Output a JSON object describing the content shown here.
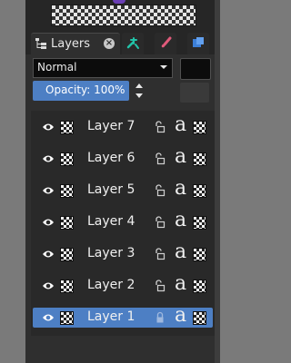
{
  "top": {
    "preview_icon": "checkerboard-preview-icon"
  },
  "tabs": {
    "layers_label": "Layers",
    "close_icon": "close-icon",
    "other_icons": [
      "tools-icon",
      "brush-icon",
      "package-icon"
    ]
  },
  "controls": {
    "blend_mode": "Normal",
    "opacity_label": "Opacity: 100%"
  },
  "layers": [
    {
      "name": "Layer 7",
      "locked": false,
      "selected": false
    },
    {
      "name": "Layer 6",
      "locked": false,
      "selected": false
    },
    {
      "name": "Layer 5",
      "locked": false,
      "selected": false
    },
    {
      "name": "Layer 4",
      "locked": false,
      "selected": false
    },
    {
      "name": "Layer 3",
      "locked": false,
      "selected": false
    },
    {
      "name": "Layer 2",
      "locked": false,
      "selected": false
    },
    {
      "name": "Layer 1",
      "locked": true,
      "selected": true
    }
  ],
  "layer_row": {
    "alpha_glyph": "a"
  },
  "colors": {
    "accent": "#4d7fc4",
    "panel": "#2f2f2f",
    "list_bg": "#292929",
    "text": "#f0f0f0"
  }
}
